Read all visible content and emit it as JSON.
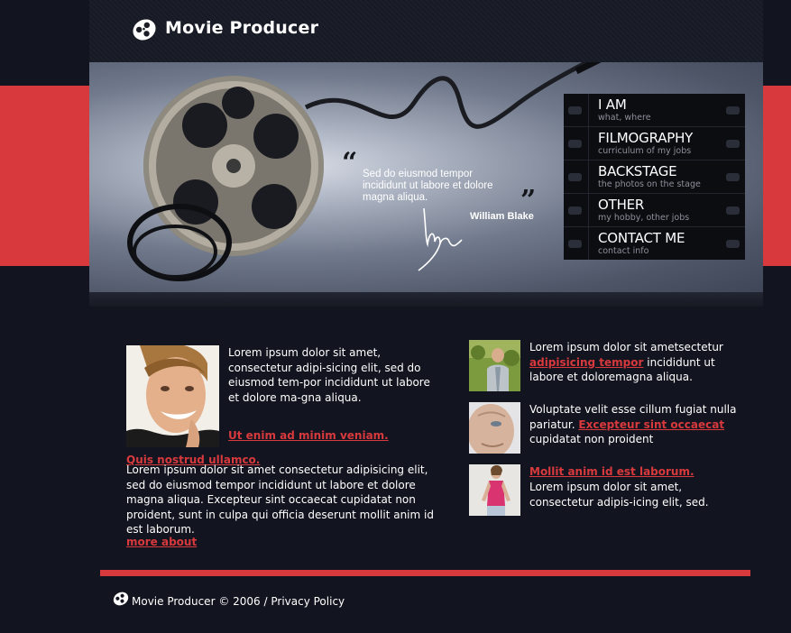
{
  "header": {
    "site_title": "Movie Producer"
  },
  "banner": {
    "quote_open": "“",
    "quote_close": "”",
    "quote_text": "Sed do eiusmod tempor incididunt ut labore et dolore magna aliqua.",
    "quote_author": "William Blake"
  },
  "menu": [
    {
      "title": "I AM",
      "subtitle": "what, where"
    },
    {
      "title": "FILMOGRAPHY",
      "subtitle": "curriculum of my jobs"
    },
    {
      "title": "BACKSTAGE",
      "subtitle": "the photos on the stage"
    },
    {
      "title": "OTHER",
      "subtitle": "my hobby, other jobs"
    },
    {
      "title": "CONTACT ME",
      "subtitle": "contact info"
    }
  ],
  "left_column": {
    "intro_text": "Lorem ipsum dolor sit amet, consectetur adipi-sicing elit, sed do eiusmod tem-por incididunt ut labore et dolore ma-gna aliqua.",
    "intro_link": "Ut enim ad minim veniam.",
    "second_heading": "Quis nostrud ullamco.",
    "second_text": "Lorem ipsum dolor sit amet consectetur adipisicing elit, sed do eiusmod tempor incididunt ut labore et dolore magna aliqua. Excepteur sint occaecat cupidatat non proident, sunt in culpa qui officia deserunt mollit anim id est laborum.",
    "more_link": "more about"
  },
  "right_column": {
    "item1": {
      "text_before": "Lorem ipsum dolor sit ametsectetur",
      "link": "adipisicing tempor",
      "text_after": "incididunt ut labore et doloremagna aliqua."
    },
    "item2": {
      "text_before": "Voluptate velit esse cillum fugiat nulla pariatur.",
      "link": "Excepteur sint occaecat",
      "text_after": "cupidatat non proident"
    },
    "item3": {
      "link": "Mollit anim id est laborum.",
      "text_after": "Lorem ipsum dolor sit amet, consectetur adipis-icing elit, sed."
    }
  },
  "footer": {
    "copyright": "Movie Producer © 2006 /",
    "privacy": "Privacy Policy"
  },
  "colors": {
    "accent": "#d7393d",
    "background": "#12151f",
    "menu_bg": "#0c0d11"
  },
  "icons": {
    "logo": "film-reel-icon",
    "footer": "film-reel-icon"
  }
}
